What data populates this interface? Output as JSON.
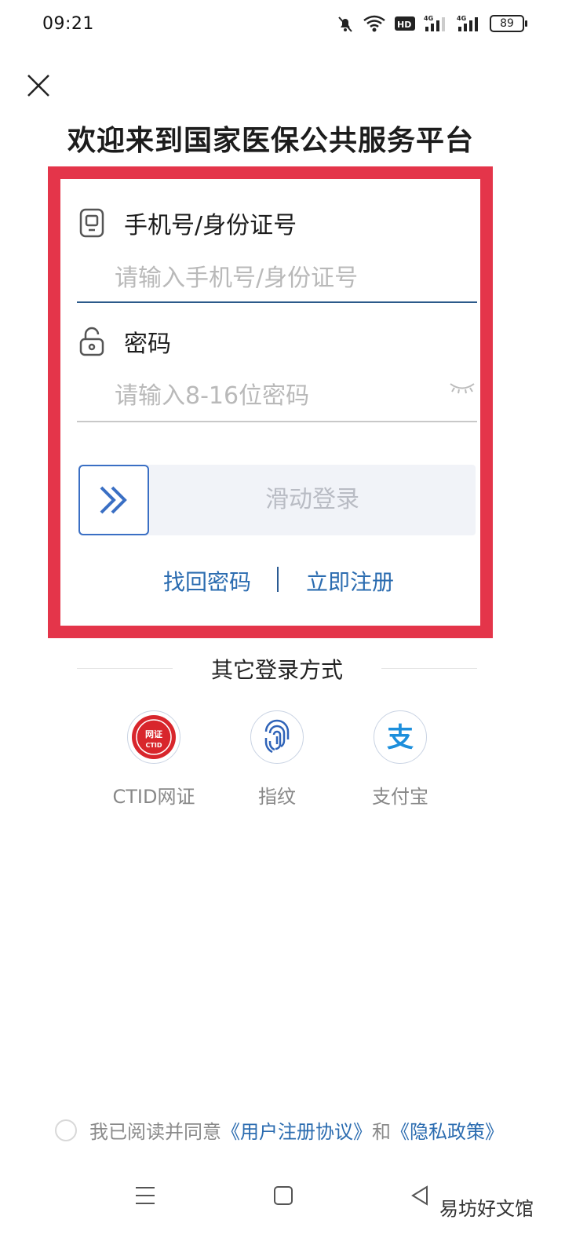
{
  "status_bar": {
    "time": "09:21",
    "battery": "89",
    "icons": [
      "mute-bell-icon",
      "wifi-icon",
      "hd-icon",
      "signal-4g-icon",
      "signal-4g-icon",
      "battery-icon"
    ]
  },
  "header": {
    "close_icon": "close-icon",
    "title": "欢迎来到国家医保公共服务平台"
  },
  "login_form": {
    "account_label": "手机号/身份证号",
    "account_placeholder": "请输入手机号/身份证号",
    "account_value": "",
    "password_label": "密码",
    "password_placeholder": "请输入8-16位密码",
    "password_value": "",
    "slider_text": "滑动登录",
    "forgot_password": "找回密码",
    "register": "立即注册"
  },
  "other_login": {
    "title": "其它登录方式",
    "options": [
      {
        "label": "CTID网证",
        "icon": "ctid-badge-icon",
        "badge_text_1": "网证",
        "badge_text_2": "CTID"
      },
      {
        "label": "指纹",
        "icon": "fingerprint-icon"
      },
      {
        "label": "支付宝",
        "icon": "alipay-icon",
        "glyph": "支"
      }
    ]
  },
  "agreement": {
    "prefix": "我已阅读并同意",
    "user_agreement": "《用户注册协议》",
    "and": "和",
    "privacy_policy": "《隐私政策》"
  },
  "watermark": "易坊好文馆",
  "colors": {
    "accent": "#2b6cb0",
    "highlight": "#e4354a",
    "slider_border": "#3a6fc4"
  }
}
